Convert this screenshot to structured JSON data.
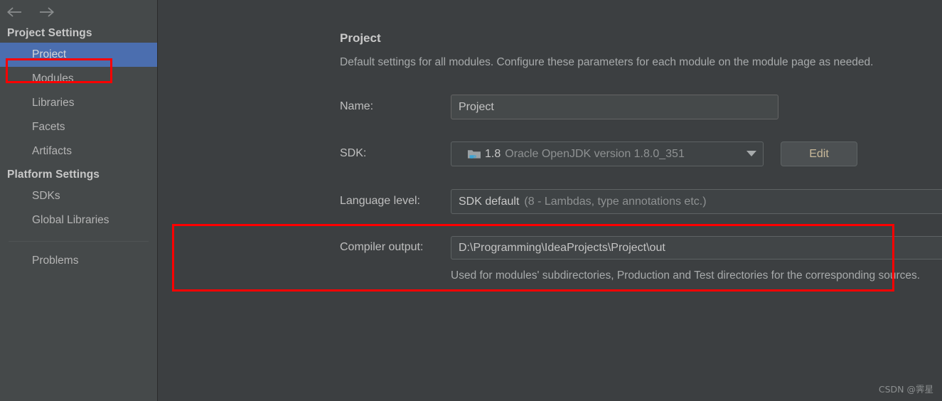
{
  "window": {
    "background_color": "#3C3F41",
    "accent_color": "#4B6EAF",
    "annotation_color": "#FF0000"
  },
  "nav": {
    "back_icon": "arrow-left-icon",
    "forward_icon": "arrow-right-icon"
  },
  "sidebar": {
    "groups": [
      {
        "title": "Project Settings",
        "items": [
          {
            "label": "Project",
            "selected": true
          },
          {
            "label": "Modules",
            "selected": false
          },
          {
            "label": "Libraries",
            "selected": false
          },
          {
            "label": "Facets",
            "selected": false
          },
          {
            "label": "Artifacts",
            "selected": false
          }
        ]
      },
      {
        "title": "Platform Settings",
        "items": [
          {
            "label": "SDKs",
            "selected": false
          },
          {
            "label": "Global Libraries",
            "selected": false
          }
        ]
      }
    ],
    "footer_items": [
      {
        "label": "Problems",
        "selected": false
      }
    ]
  },
  "main": {
    "title": "Project",
    "subtitle": "Default settings for all modules. Configure these parameters for each module on the module page as needed.",
    "fields": {
      "name": {
        "label": "Name:",
        "value": "Project"
      },
      "sdk": {
        "label": "SDK:",
        "icon": "jdk-folder-icon",
        "value_bright": "1.8",
        "value_dim": "Oracle OpenJDK version 1.8.0_351",
        "dropdown_icon": "chevron-down-icon",
        "edit_button": "Edit"
      },
      "language_level": {
        "label": "Language level:",
        "value_bright": "SDK default",
        "value_dim": "(8 - Lambdas, type annotations etc.)",
        "dropdown_icon": "chevron-down-icon"
      },
      "compiler_output": {
        "label": "Compiler output:",
        "value": "D:\\Programming\\IdeaProjects\\Project\\out",
        "browse_icon": "folder-open-icon",
        "hint": "Used for modules' subdirectories, Production and Test directories for the corresponding sources."
      }
    }
  },
  "watermark": "CSDN @霁星"
}
